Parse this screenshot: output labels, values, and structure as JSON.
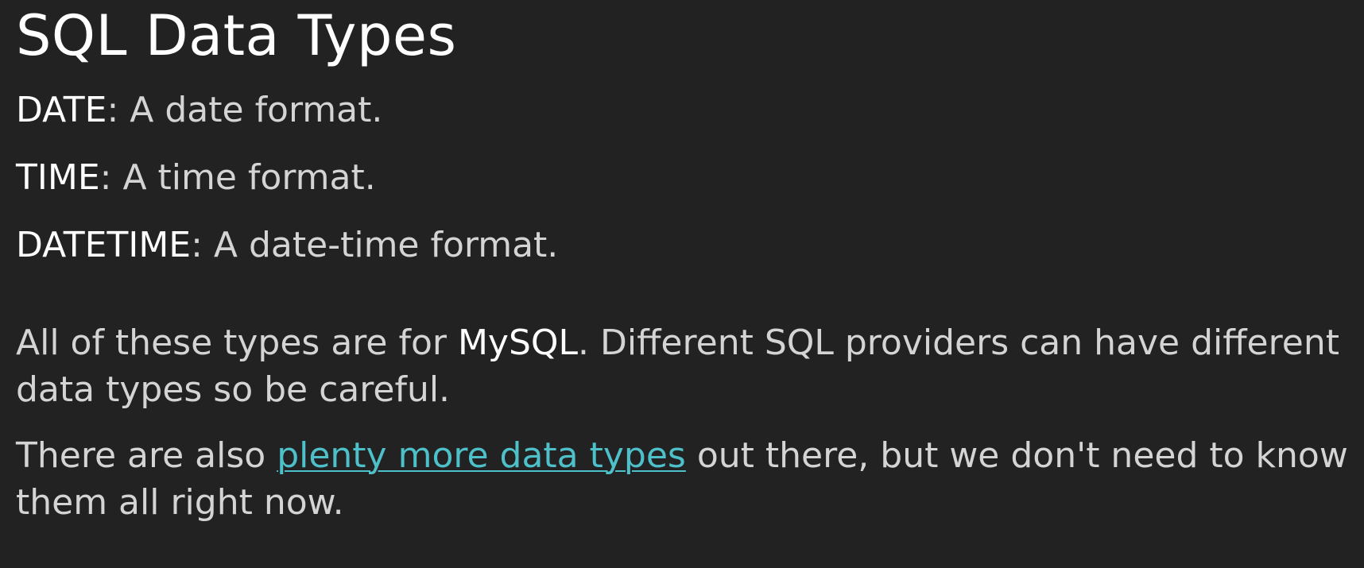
{
  "title": "SQL Data Types",
  "definitions": [
    {
      "term": "DATE",
      "sep": ":",
      "desc": " A date format."
    },
    {
      "term": "TIME",
      "sep": ":",
      "desc": " A time format."
    },
    {
      "term": "DATETIME",
      "sep": ":",
      "desc": " A date-time format."
    }
  ],
  "paragraph1": {
    "before": "All of these types are for ",
    "strong": "MySQL",
    "after": ". Different SQL providers can have different data types so be careful."
  },
  "paragraph2": {
    "before": "There are also ",
    "link": "plenty more data types",
    "after": " out there, but we don't need to know them all right now."
  },
  "colors": {
    "background": "#222222",
    "text": "#d4d4d4",
    "heading": "#ffffff",
    "link": "#4ec0c9"
  }
}
